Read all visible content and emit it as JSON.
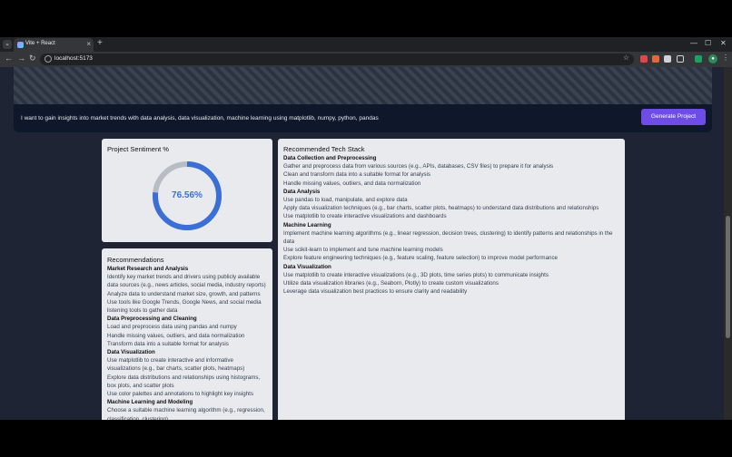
{
  "browser": {
    "tab_title": "Vite + React",
    "url": "localhost:5173"
  },
  "hero": {
    "prompt": "I want to gain insights into market trends with data analysis, data visualization, machine learning using matplotlib, numpy, python, pandas",
    "button_label": "Generate Project"
  },
  "sentiment": {
    "title": "Project Sentiment %",
    "value_label": "76.56%",
    "value_fraction": 0.7656,
    "colors": {
      "fill": "#3b6fd6",
      "track": "#b8bcc4"
    }
  },
  "recommendations": {
    "title": "Recommendations",
    "sections": [
      {
        "heading": "Market Research and Analysis",
        "items": [
          "Identify key market trends and drivers using publicly available data sources (e.g., news articles, social media, industry reports)",
          "Analyze data to understand market size, growth, and patterns",
          "Use tools like Google Trends, Google News, and social media listening tools to gather data"
        ]
      },
      {
        "heading": "Data Preprocessing and Cleaning",
        "items": [
          "Load and preprocess data using pandas and numpy",
          "Handle missing values, outliers, and data normalization",
          "Transform data into a suitable format for analysis"
        ]
      },
      {
        "heading": "Data Visualization",
        "items": [
          "Use matplotlib to create interactive and informative visualizations (e.g., bar charts, scatter plots, heatmaps)",
          "Explore data distributions and relationships using histograms, box plots, and scatter plots",
          "Use color palettes and annotations to highlight key insights"
        ]
      },
      {
        "heading": "Machine Learning and Modeling",
        "items": [
          "Choose a suitable machine learning algorithm (e.g., regression, classification, clustering)"
        ]
      }
    ]
  },
  "tech_stack": {
    "title": "Recommended Tech Stack",
    "sections": [
      {
        "heading": "Data Collection and Preprocessing",
        "items": [
          "Gather and preprocess data from various sources (e.g., APIs, databases, CSV files) to prepare it for analysis",
          "Clean and transform data into a suitable format for analysis",
          "Handle missing values, outliers, and data normalization"
        ]
      },
      {
        "heading": "Data Analysis",
        "items": [
          "Use pandas to load, manipulate, and explore data",
          "Apply data visualization techniques (e.g., bar charts, scatter plots, heatmaps) to understand data distributions and relationships",
          "Use matplotlib to create interactive visualizations and dashboards"
        ]
      },
      {
        "heading": "Machine Learning",
        "items": [
          "Implement machine learning algorithms (e.g., linear regression, decision trees, clustering) to identify patterns and relationships in the data",
          "Use scikit-learn to implement and tune machine learning models",
          "Explore feature engineering techniques (e.g., feature scaling, feature selection) to improve model performance"
        ]
      },
      {
        "heading": "Data Visualization",
        "items": [
          "Use matplotlib to create interactive visualizations (e.g., 3D plots, time series plots) to communicate insights",
          "Utilize data visualization libraries (e.g., Seaborn, Plotly) to create custom visualizations",
          "Leverage data visualization best practices to ensure clarity and readability"
        ]
      }
    ]
  }
}
